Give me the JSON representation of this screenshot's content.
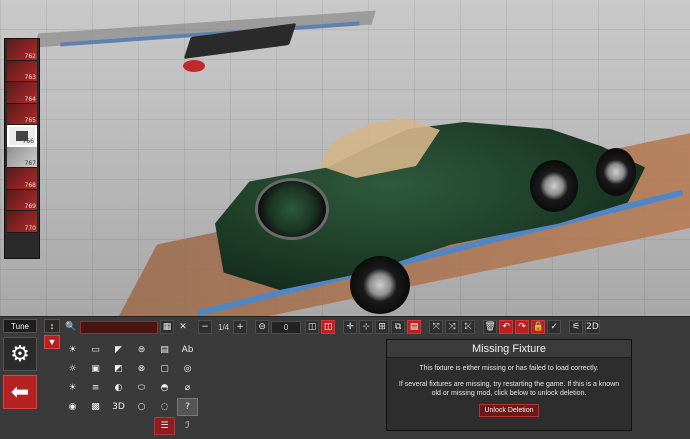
{
  "fixture_strip": {
    "items": [
      {
        "number": "762"
      },
      {
        "number": "763"
      },
      {
        "number": "764"
      },
      {
        "number": "765"
      },
      {
        "number": "766"
      },
      {
        "number": "767"
      },
      {
        "number": "768"
      },
      {
        "number": "769"
      },
      {
        "number": "770"
      }
    ],
    "selected": "766"
  },
  "tune": {
    "label": "Tune"
  },
  "toolbar": {
    "search_value": "",
    "page_indicator": "1/4",
    "zoom_value": "0",
    "view_2d_label": "2D"
  },
  "fixture_grid": {
    "rows": [
      [
        "",
        "",
        "Ab"
      ],
      [
        "",
        "",
        ""
      ],
      [
        "",
        "",
        ""
      ],
      [
        "",
        "3D",
        ""
      ]
    ]
  },
  "dialog": {
    "title": "Missing Fixture",
    "line1": "This fixture is either missing or has failed to load correctly.",
    "line2": "If several fixtures are missing, try restarting the game. If this is a known old or missing mod, click below to unlock deletion.",
    "unlock_label": "Unlock Deletion"
  },
  "colors": {
    "accent_red": "#b52222",
    "panel": "#3a3a3a"
  }
}
